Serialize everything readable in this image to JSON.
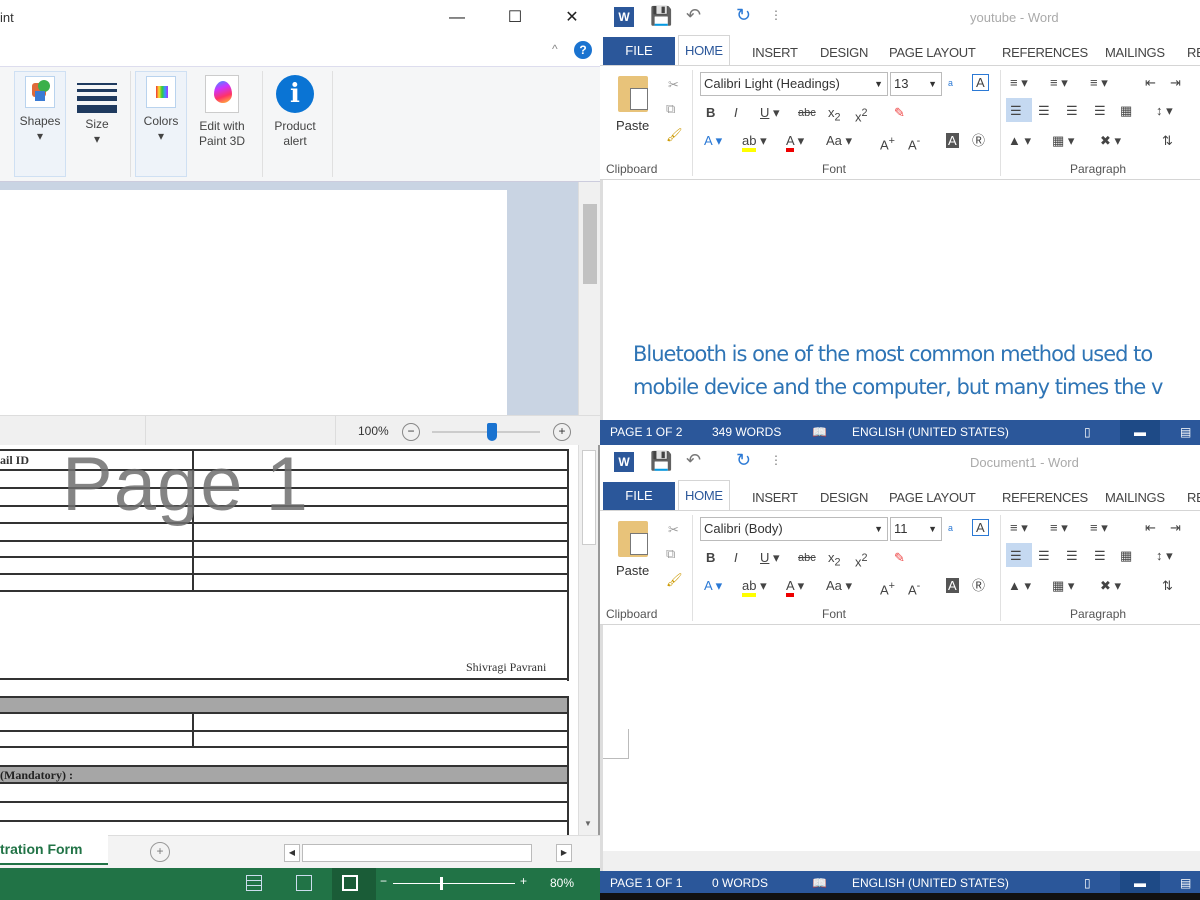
{
  "paint": {
    "title": "int",
    "help": "?",
    "collapse": "^",
    "tools": [
      {
        "label": "Shapes",
        "arrow": "▾"
      },
      {
        "label": "Size",
        "arrow": "▾"
      },
      {
        "label": "Colors",
        "arrow": "▾"
      },
      {
        "label": "Edit with Paint 3D"
      },
      {
        "label": "Product alert"
      }
    ],
    "zoom": "100%",
    "zoom_fraction": 0.55
  },
  "excel": {
    "cell_email": "ail ID",
    "watermark": "Page 1",
    "signature": "Shivragi Pavrani",
    "mandatory": "(Mandatory) :",
    "sheet_tab": "tration Form",
    "zoom": "80%",
    "colors": {
      "status": "#217346"
    }
  },
  "words": [
    {
      "title": "youtube - Word",
      "tabs": [
        "FILE",
        "HOME",
        "INSERT",
        "DESIGN",
        "PAGE LAYOUT",
        "REFERENCES",
        "MAILINGS",
        "RE"
      ],
      "font": "Calibri Light (Headings)",
      "size": "13",
      "groups": [
        "Clipboard",
        "Font",
        "Paragraph"
      ],
      "paste": "Paste",
      "text": [
        "Bluetooth is one of the most common method used to",
        "mobile device and the computer, but many times the v"
      ],
      "status": {
        "page": "PAGE 1 OF 2",
        "words": "349 WORDS",
        "lang": "ENGLISH (UNITED STATES)"
      }
    },
    {
      "title": "Document1 - Word",
      "tabs": [
        "FILE",
        "HOME",
        "INSERT",
        "DESIGN",
        "PAGE LAYOUT",
        "REFERENCES",
        "MAILINGS",
        "RE"
      ],
      "font": "Calibri (Body)",
      "size": "11",
      "groups": [
        "Clipboard",
        "Font",
        "Paragraph"
      ],
      "paste": "Paste",
      "text": [],
      "status": {
        "page": "PAGE 1 OF 1",
        "words": "0 WORDS",
        "lang": "ENGLISH (UNITED STATES)"
      }
    }
  ],
  "colors": {
    "word_blue": "#2b579a",
    "doc_text": "#2e74b5"
  }
}
